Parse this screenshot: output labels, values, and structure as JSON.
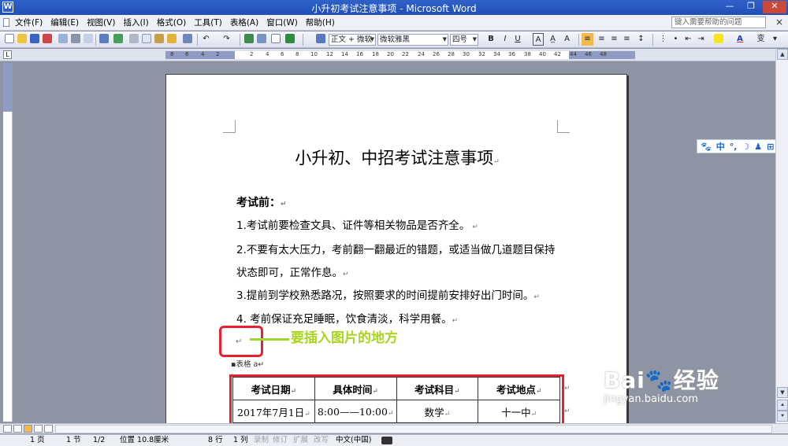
{
  "window": {
    "title": "小升初考试注意事项 - Microsoft Word",
    "minimize": "—",
    "restore": "❐",
    "close": "✕"
  },
  "menu": {
    "items": [
      "文件(F)",
      "编辑(E)",
      "视图(V)",
      "插入(I)",
      "格式(O)",
      "工具(T)",
      "表格(A)",
      "窗口(W)",
      "帮助(H)"
    ],
    "help_placeholder": "键入需要帮助的问题",
    "help_close": "×"
  },
  "toolbar": {
    "style_value": "正文 + 微软",
    "font_value": "微软雅黑",
    "size_value": "四号",
    "bold": "B",
    "italic": "I",
    "underline": "U",
    "char_border": "A",
    "font_color": "A"
  },
  "ruler": {
    "corner": "L",
    "numbers": [
      "8",
      "6",
      "4",
      "2",
      "2",
      "4",
      "6",
      "8",
      "10",
      "12",
      "14",
      "16",
      "18",
      "20",
      "22",
      "24",
      "26",
      "28",
      "30",
      "32",
      "34",
      "36",
      "38",
      "40",
      "42",
      "44",
      "46",
      "48"
    ]
  },
  "ime": {
    "items": [
      "🐾",
      "中",
      "°,",
      "☽",
      "♟",
      "⊞"
    ]
  },
  "document": {
    "title": "小升初、中招考试注意事项",
    "section_heading": "考试前：",
    "paragraphs": [
      "1.考试前要检查文具、证件等相关物品是否齐全。",
      "2.不要有太大压力，考前翻一翻最近的错题，或适当做几道题目保持",
      "状态即可，正常作息。",
      "3.提前到学校熟悉路况，按照要求的时间提前安排好出门时间。",
      "4. 考前保证充足睡眠，饮食清淡，科学用餐。"
    ],
    "paragraph_mark": "↵",
    "annotation": "要插入图片的地方",
    "caption": "▪表格 a↵",
    "table": {
      "headers": [
        "考试日期",
        "具体时间",
        "考试科目",
        "考试地点"
      ],
      "rows": [
        [
          "2017年7月1日",
          "8:00——10:00",
          "数学",
          "十一中"
        ]
      ]
    }
  },
  "status": {
    "page": "1 页",
    "section": "1 节",
    "page_of": "1/2",
    "position": "位置 10.8厘米",
    "line": "8 行",
    "column": "1 列",
    "rec": "录制",
    "trk": "修订",
    "ext": "扩展",
    "ovr": "改写",
    "language": "中文(中国)"
  },
  "watermark": {
    "brand": "Bai🐾经验",
    "url": "jingyan.baidu.com"
  }
}
